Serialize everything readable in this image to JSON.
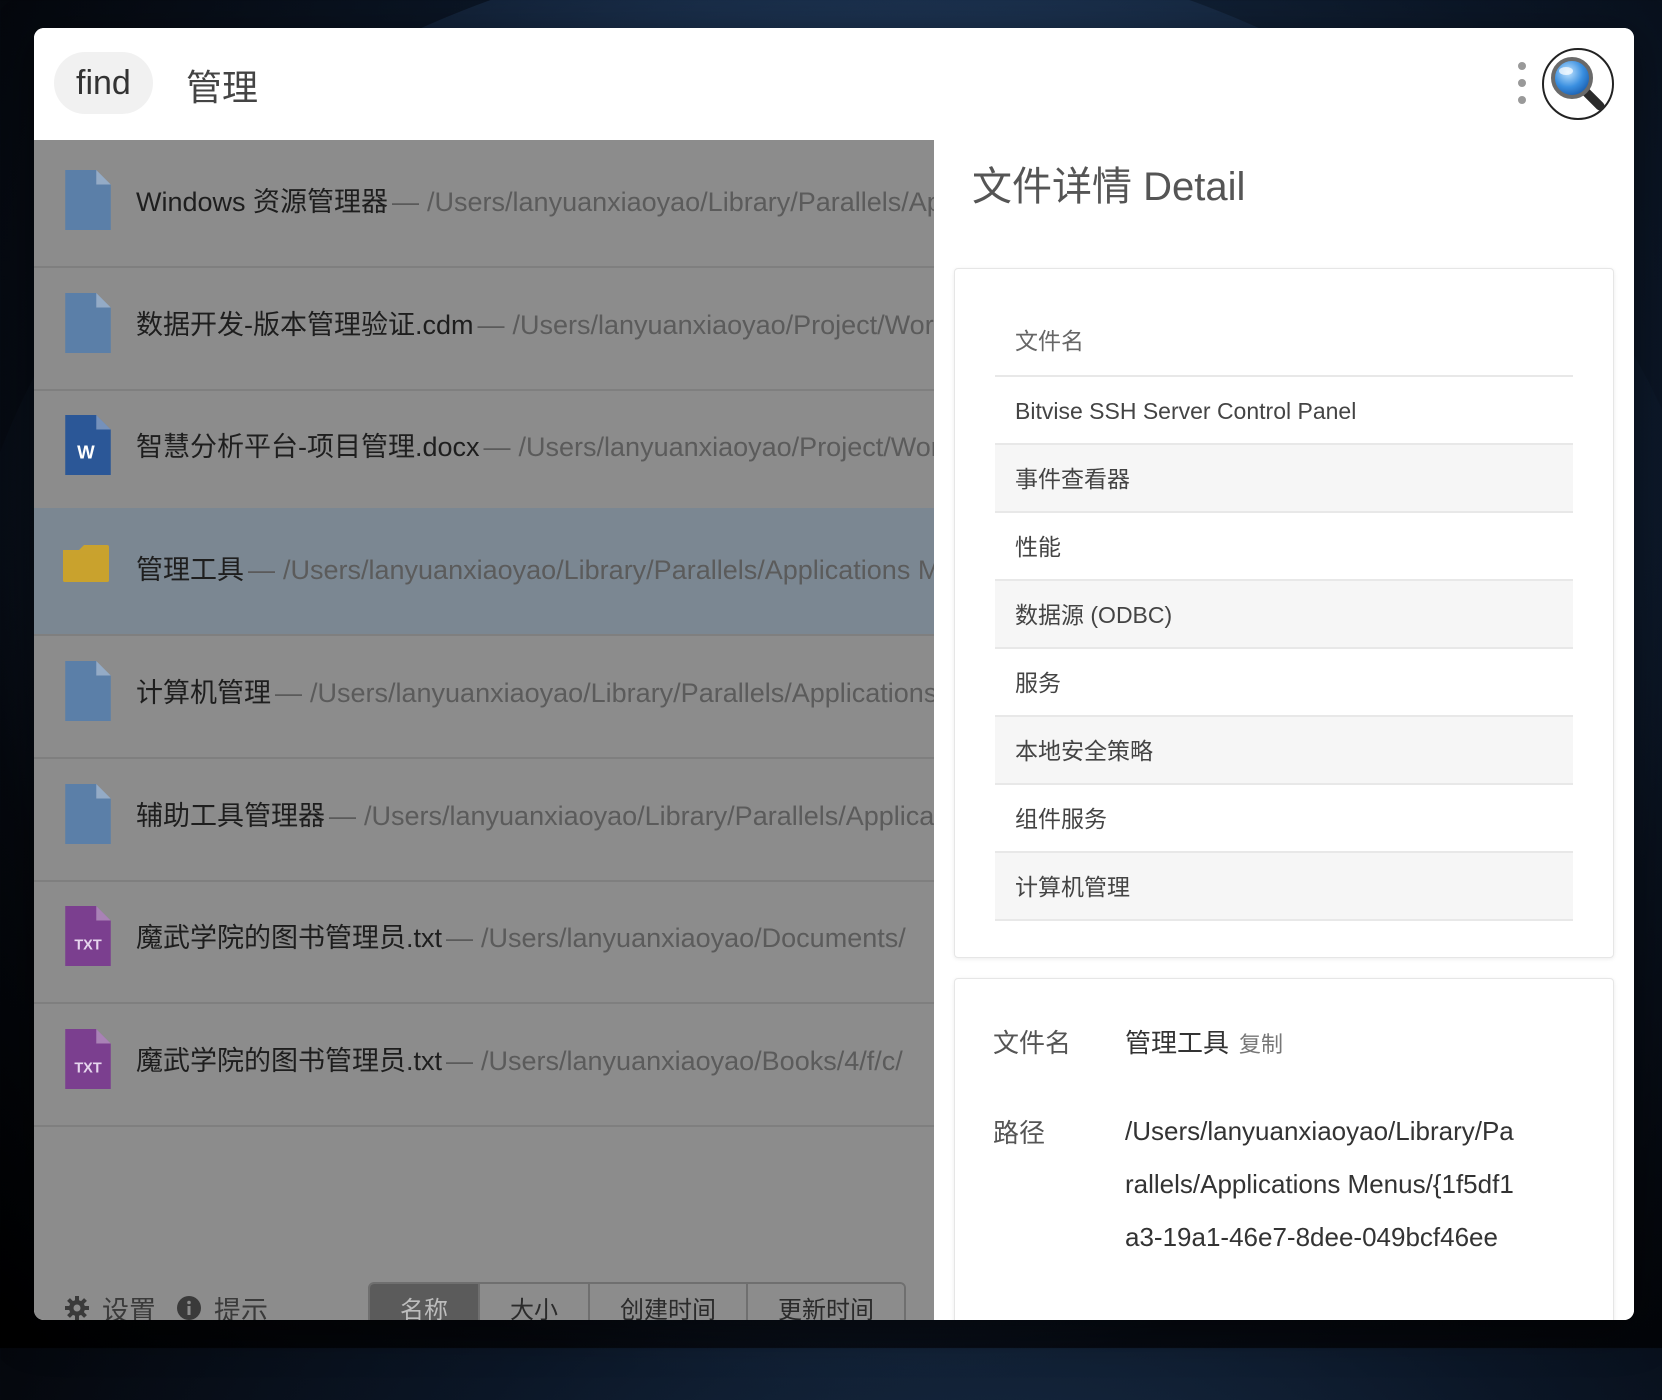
{
  "search": {
    "mode": "find",
    "query": "管理"
  },
  "results": [
    {
      "icon": "file",
      "name": "Windows 资源管理器",
      "path": "/Users/lanyuanxiaoyao/Library/Parallels/Applications Menus/"
    },
    {
      "icon": "file",
      "name": "数据开发-版本管理验证.cdm",
      "path": "/Users/lanyuanxiaoyao/Project/Work/"
    },
    {
      "icon": "word",
      "name": "智慧分析平台-项目管理.docx",
      "path": "/Users/lanyuanxiaoyao/Project/Work/"
    },
    {
      "icon": "folder",
      "name": "管理工具",
      "path": "/Users/lanyuanxiaoyao/Library/Parallels/Applications Menus/"
    },
    {
      "icon": "file",
      "name": "计算机管理",
      "path": "/Users/lanyuanxiaoyao/Library/Parallels/Applications Menus/"
    },
    {
      "icon": "file",
      "name": "辅助工具管理器",
      "path": "/Users/lanyuanxiaoyao/Library/Parallels/Applications Menus/"
    },
    {
      "icon": "txt",
      "name": "魔武学院的图书管理员.txt",
      "path": "/Users/lanyuanxiaoyao/Documents/"
    },
    {
      "icon": "txt",
      "name": "魔武学院的图书管理员.txt",
      "path": "/Users/lanyuanxiaoyao/Books/4/f/c/"
    }
  ],
  "result_separator": "—",
  "bottom": {
    "settings_label": "设置",
    "tips_label": "提示",
    "sort_buttons": [
      "名称",
      "大小",
      "创建时间",
      "更新时间"
    ]
  },
  "detail": {
    "title": "文件详情 Detail",
    "list_header": "文件名",
    "list_items": [
      "Bitvise SSH Server Control Panel",
      "事件查看器",
      "性能",
      "数据源 (ODBC)",
      "服务",
      "本地安全策略",
      "组件服务",
      "计算机管理"
    ],
    "name_label": "文件名",
    "name_value": "管理工具",
    "copy_label": "复制",
    "path_label": "路径",
    "path_lines": [
      "/Users/lanyuanxiaoyao/Library/Pa",
      "rallels/Applications Menus/{1f5df1",
      "a3-19a1-46e7-8dee-049bcf46ee"
    ]
  },
  "colors": {
    "file": "#5b7fa8",
    "word": "#2b5797",
    "folder": "#c9a22e",
    "txt": "#7b3f8f"
  }
}
